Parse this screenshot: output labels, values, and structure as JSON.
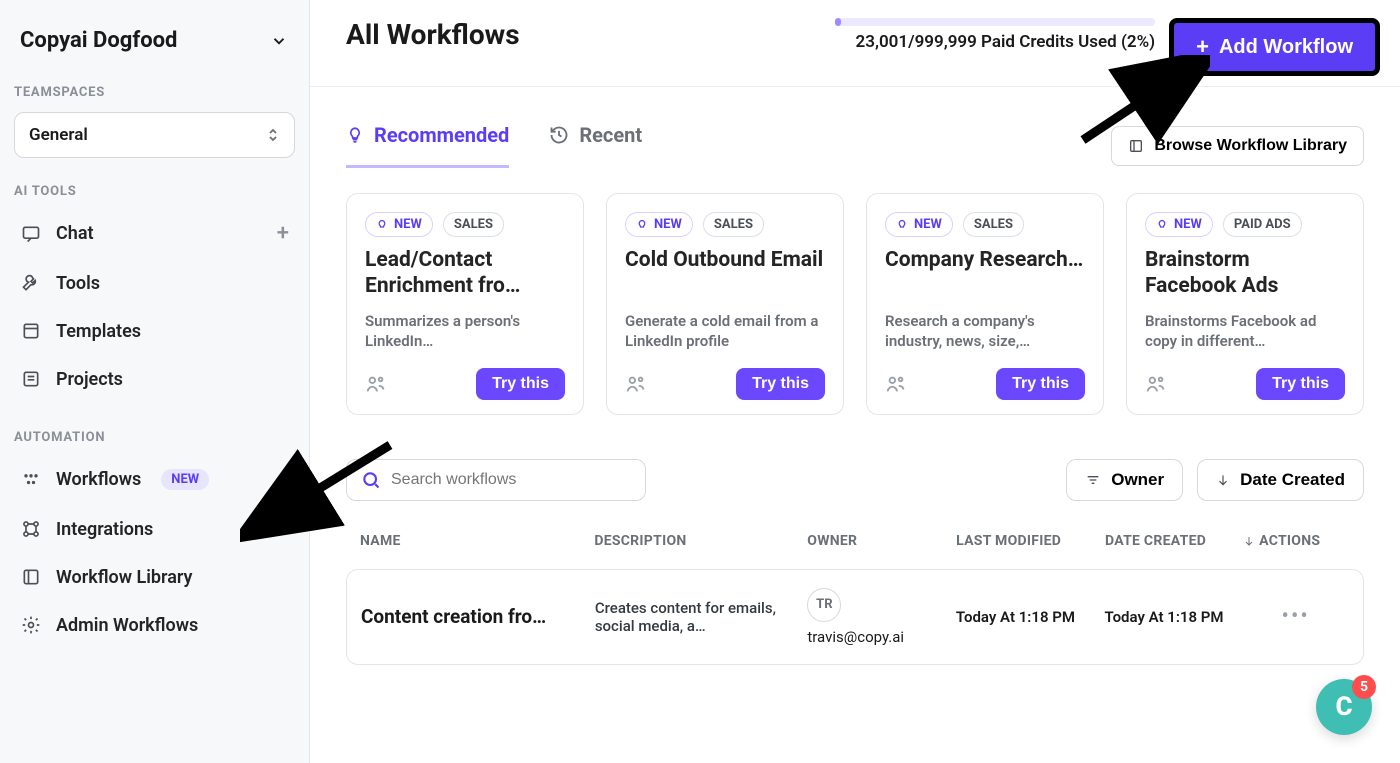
{
  "workspace": {
    "name": "Copyai Dogfood"
  },
  "teamspaces_label": "TEAMSPACES",
  "teamspace_selected": "General",
  "ai_tools_label": "AI TOOLS",
  "ai_tools": [
    {
      "label": "Chat"
    },
    {
      "label": "Tools"
    },
    {
      "label": "Templates"
    },
    {
      "label": "Projects"
    }
  ],
  "automation_label": "AUTOMATION",
  "automation": [
    {
      "label": "Workflows",
      "badge": "NEW",
      "has_plus": true
    },
    {
      "label": "Integrations"
    },
    {
      "label": "Workflow Library"
    },
    {
      "label": "Admin Workflows"
    }
  ],
  "page_title": "All Workflows",
  "credits": {
    "used": "23,001",
    "total": "999,999",
    "percent": "2%",
    "text": "23,001/999,999 Paid Credits Used (2%)"
  },
  "add_workflow_label": "Add Workflow",
  "tabs": {
    "recommended": "Recommended",
    "recent": "Recent"
  },
  "browse_library_label": "Browse Workflow Library",
  "cards": [
    {
      "new": "NEW",
      "tag": "SALES",
      "title": "Lead/Contact Enrichment fro…",
      "desc": "Summarizes a person's LinkedIn…",
      "cta": "Try this"
    },
    {
      "new": "NEW",
      "tag": "SALES",
      "title": "Cold Outbound Email",
      "desc": "Generate a cold email from a LinkedIn profile",
      "cta": "Try this"
    },
    {
      "new": "NEW",
      "tag": "SALES",
      "title": "Company Research…",
      "desc": "Research a company's industry, news, size,…",
      "cta": "Try this"
    },
    {
      "new": "NEW",
      "tag": "PAID ADS",
      "title": "Brainstorm Facebook Ads",
      "desc": "Brainstorms Facebook ad copy in different…",
      "cta": "Try this"
    }
  ],
  "search_placeholder": "Search workflows",
  "filters": {
    "owner": "Owner",
    "date_created": "Date Created"
  },
  "columns": {
    "name": "NAME",
    "description": "DESCRIPTION",
    "owner": "OWNER",
    "last_modified": "LAST MODIFIED",
    "date_created": "DATE CREATED",
    "actions": "ACTIONS"
  },
  "rows": [
    {
      "name": "Content creation fro…",
      "description": "Creates content for emails, social media, a…",
      "owner_initials": "TR",
      "owner_email": "travis@copy.ai",
      "last_modified": "Today At 1:18 PM",
      "date_created": "Today At 1:18 PM"
    }
  ],
  "fab_label": "C",
  "fab_count": "5"
}
